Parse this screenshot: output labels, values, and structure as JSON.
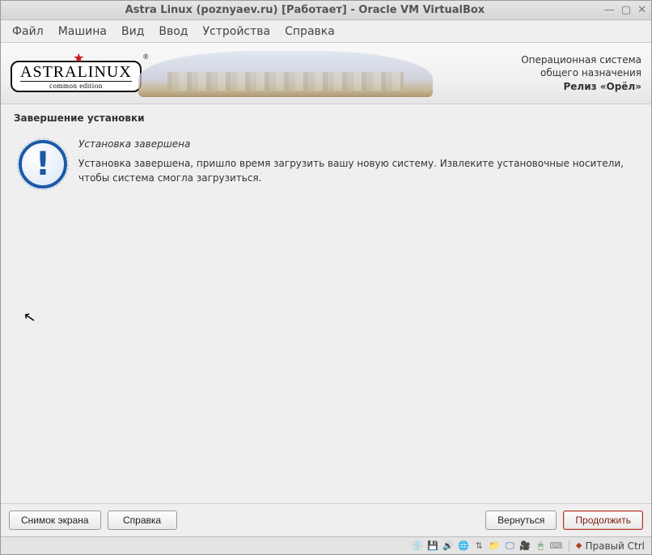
{
  "titlebar": {
    "title": "Astra Linux (poznyaev.ru) [Работает] - Oracle VM VirtualBox"
  },
  "menubar": {
    "file": "Файл",
    "machine": "Машина",
    "view": "Вид",
    "input": "Ввод",
    "devices": "Устройства",
    "help": "Справка"
  },
  "logo": {
    "main": "ASTRALINUX",
    "sub": "common edition"
  },
  "banner": {
    "line1": "Операционная система",
    "line2": "общего назначения",
    "line3": "Релиз «Орёл»"
  },
  "installer": {
    "section_title": "Завершение установки",
    "heading": "Установка завершена",
    "body": "Установка завершена, пришло время загрузить вашу новую систему. Извлеките установочные носители, чтобы система смогла загрузиться."
  },
  "buttons": {
    "screenshot": "Снимок экрана",
    "help": "Справка",
    "back": "Вернуться",
    "continue": "Продолжить"
  },
  "statusbar": {
    "host_key": "Правый Ctrl"
  },
  "icons": {
    "disk": "💿",
    "hdd": "💾",
    "audio": "🔊",
    "net": "🌐",
    "usb": "⇅",
    "folder": "📁",
    "display": "🖵",
    "rec": "🎥",
    "mouse": "🖱",
    "kbd": "⌨"
  }
}
